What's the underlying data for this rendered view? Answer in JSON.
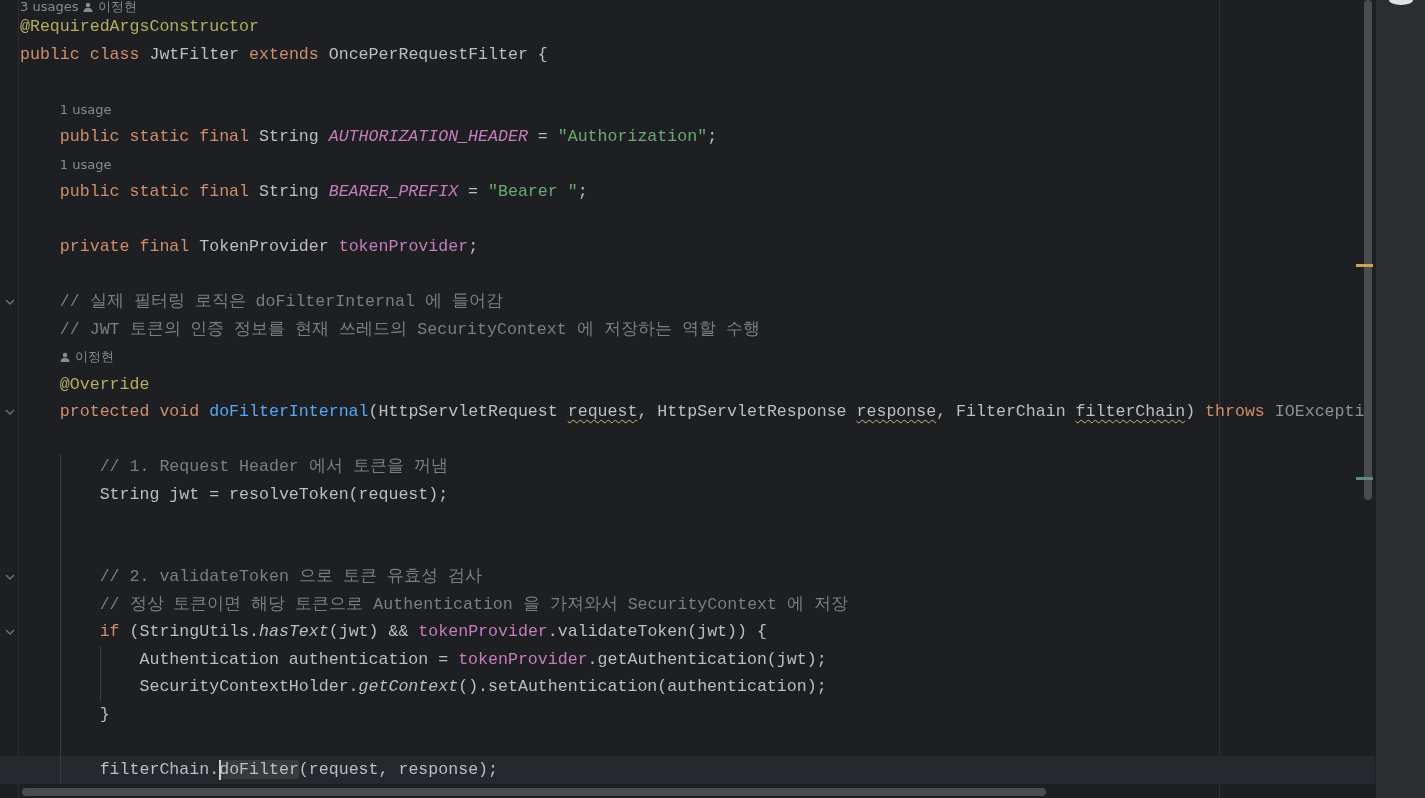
{
  "editor": {
    "lines": [
      {
        "kind": "hint",
        "usages": "3 usages",
        "author": "이정현"
      },
      {
        "kind": "code",
        "tokens": [
          {
            "kind": "annotation",
            "text": "@RequiredArgsConstructor"
          }
        ]
      },
      {
        "kind": "code",
        "tokens": [
          {
            "kind": "keyword",
            "text": "public"
          },
          {
            "kind": "keyword",
            "text": " class"
          },
          {
            "kind": "plain",
            "text": " JwtFilter "
          },
          {
            "kind": "keyword",
            "text": "extends"
          },
          {
            "kind": "plain",
            "text": " OncePerRequestFilter {"
          }
        ]
      },
      {
        "kind": "blank"
      },
      {
        "kind": "hint",
        "usages": "1 usage"
      },
      {
        "kind": "code",
        "tokens": [
          {
            "kind": "keyword",
            "text": "    public static final"
          },
          {
            "kind": "plain",
            "text": " String "
          },
          {
            "kind": "constant",
            "text": "AUTHORIZATION_HEADER"
          },
          {
            "kind": "plain",
            "text": " = "
          },
          {
            "kind": "string",
            "text": "\"Authorization\""
          },
          {
            "kind": "plain",
            "text": ";"
          }
        ]
      },
      {
        "kind": "hint",
        "usages": "1 usage"
      },
      {
        "kind": "code",
        "tokens": [
          {
            "kind": "keyword",
            "text": "    public static final"
          },
          {
            "kind": "plain",
            "text": " String "
          },
          {
            "kind": "constant",
            "text": "BEARER_PREFIX"
          },
          {
            "kind": "plain",
            "text": " = "
          },
          {
            "kind": "string",
            "text": "\"Bearer \""
          },
          {
            "kind": "plain",
            "text": ";"
          }
        ]
      },
      {
        "kind": "blank"
      },
      {
        "kind": "code",
        "tokens": [
          {
            "kind": "keyword",
            "text": "    private final"
          },
          {
            "kind": "plain",
            "text": " TokenProvider "
          },
          {
            "kind": "field",
            "text": "tokenProvider"
          },
          {
            "kind": "plain",
            "text": ";"
          }
        ]
      },
      {
        "kind": "blank"
      },
      {
        "kind": "code",
        "fold": true,
        "tokens": [
          {
            "kind": "comment",
            "text": "    // 실제 필터링 로직은 doFilterInternal 에 들어감"
          }
        ]
      },
      {
        "kind": "code",
        "tokens": [
          {
            "kind": "comment",
            "text": "    // JWT 토큰의 인증 정보를 현재 쓰레드의 SecurityContext 에 저장하는 역할 수행"
          }
        ]
      },
      {
        "kind": "hint",
        "author": "이정현"
      },
      {
        "kind": "code",
        "tokens": [
          {
            "kind": "annotation",
            "text": "    @Override"
          }
        ]
      },
      {
        "kind": "code",
        "fold": true,
        "tokens": [
          {
            "kind": "keyword",
            "text": "    protected void"
          },
          {
            "kind": "method",
            "text": " doFilterInternal"
          },
          {
            "kind": "plain",
            "text": "(HttpServletRequest "
          },
          {
            "kind": "warning",
            "text": "request"
          },
          {
            "kind": "plain",
            "text": ", HttpServletResponse "
          },
          {
            "kind": "warning",
            "text": "response"
          },
          {
            "kind": "plain",
            "text": ", FilterChain "
          },
          {
            "kind": "warning",
            "text": "filterChain"
          },
          {
            "kind": "plain",
            "text": ") "
          },
          {
            "kind": "keyword",
            "text": "throws "
          },
          {
            "kind": "unused",
            "text": "IOExcepti"
          }
        ]
      },
      {
        "kind": "blank"
      },
      {
        "kind": "code",
        "tokens": [
          {
            "kind": "comment",
            "text": "        // 1. Request Header 에서 토큰을 꺼냄"
          }
        ]
      },
      {
        "kind": "code",
        "tokens": [
          {
            "kind": "plain",
            "text": "        String jwt = resolveToken(request);"
          }
        ]
      },
      {
        "kind": "blank"
      },
      {
        "kind": "blank"
      },
      {
        "kind": "code",
        "fold": true,
        "tokens": [
          {
            "kind": "comment",
            "text": "        // 2. validateToken 으로 토큰 유효성 검사"
          }
        ]
      },
      {
        "kind": "code",
        "tokens": [
          {
            "kind": "comment",
            "text": "        // 정상 토큰이면 해당 토큰으로 Authentication 을 가져와서 SecurityContext 에 저장"
          }
        ]
      },
      {
        "kind": "code",
        "fold": true,
        "tokens": [
          {
            "kind": "keyword",
            "text": "        if"
          },
          {
            "kind": "plain",
            "text": " (StringUtils."
          },
          {
            "kind": "static",
            "text": "hasText"
          },
          {
            "kind": "plain",
            "text": "(jwt) && "
          },
          {
            "kind": "field",
            "text": "tokenProvider"
          },
          {
            "kind": "plain",
            "text": ".validateToken(jwt)) {"
          }
        ]
      },
      {
        "kind": "code",
        "tokens": [
          {
            "kind": "plain",
            "text": "            Authentication authentication = "
          },
          {
            "kind": "field",
            "text": "tokenProvider"
          },
          {
            "kind": "plain",
            "text": ".getAuthentication(jwt);"
          }
        ]
      },
      {
        "kind": "code",
        "tokens": [
          {
            "kind": "plain",
            "text": "            SecurityContextHolder."
          },
          {
            "kind": "static",
            "text": "getContext"
          },
          {
            "kind": "plain",
            "text": "().setAuthentication(authentication);"
          }
        ]
      },
      {
        "kind": "code",
        "tokens": [
          {
            "kind": "plain",
            "text": "        }"
          }
        ]
      },
      {
        "kind": "blank"
      },
      {
        "kind": "code",
        "current": true,
        "tokens": [
          {
            "kind": "plain",
            "text": "        filterChain."
          },
          {
            "kind": "usage",
            "text": "doFilter",
            "caret": true
          },
          {
            "kind": "plain",
            "text": "(request, response);"
          }
        ]
      }
    ]
  }
}
